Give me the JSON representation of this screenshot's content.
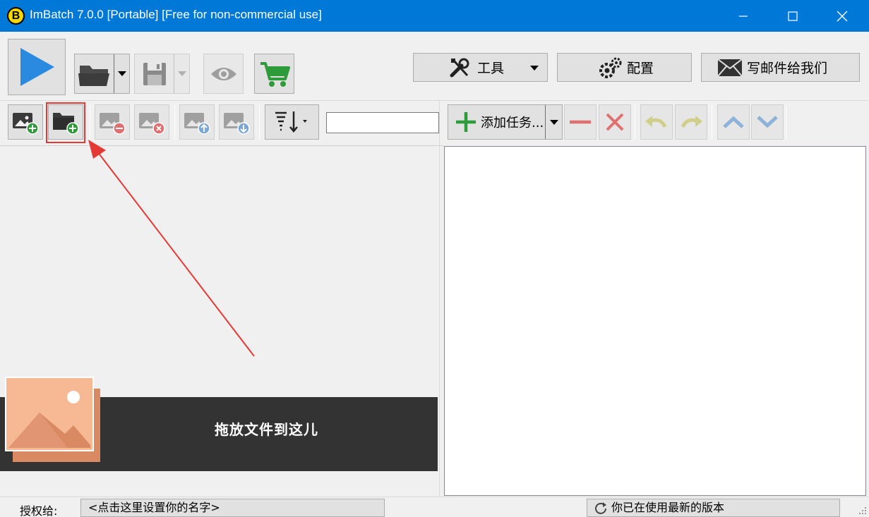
{
  "window": {
    "title": "ImBatch 7.0.0 [Portable] [Free for non-commercial use]",
    "logo_letter": "B"
  },
  "toolbar": {
    "tools_label": "工具",
    "config_label": "配置",
    "email_label": "写邮件给我们"
  },
  "task_toolbar": {
    "add_task_label": "添加任务..."
  },
  "file_panel": {
    "search_value": "",
    "drop_text": "拖放文件到这儿"
  },
  "status": {
    "licensed_to_label": "授权给:",
    "name_field": "<点击这里设置你的名字>",
    "version_status": "你已在使用最新的版本"
  },
  "colors": {
    "titlebar": "#0078d7",
    "accent_green": "#2e9b3a",
    "play_blue": "#2a8ae0",
    "drop_zone": "#333333",
    "highlight_red": "#e53935"
  }
}
